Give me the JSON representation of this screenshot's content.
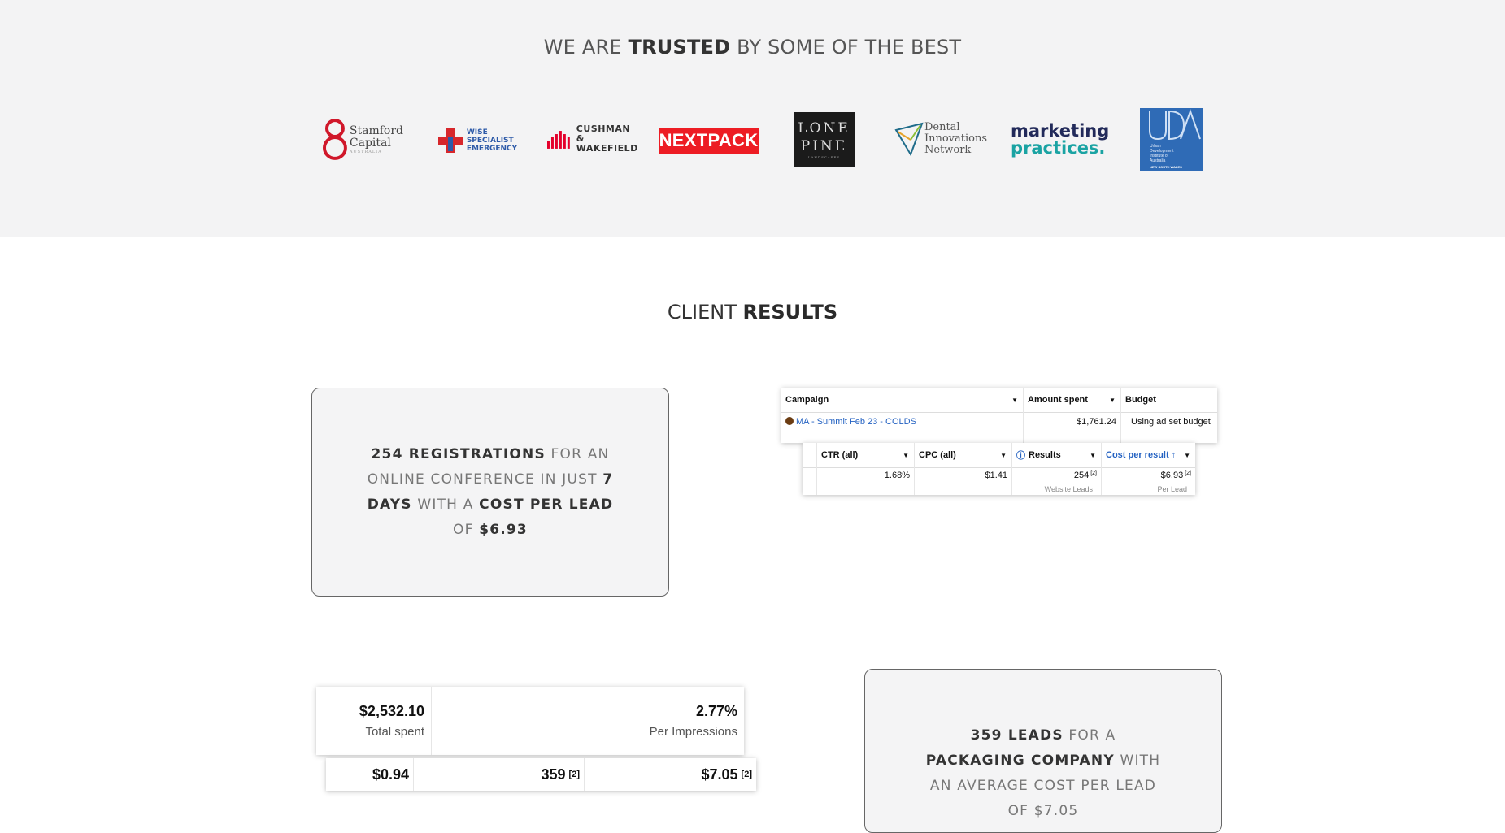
{
  "trusted": {
    "title_pre": "WE ARE ",
    "title_bold": "TRUSTED",
    "title_post": " BY SOME OF THE BEST",
    "logos": {
      "stamford": {
        "line1": "Stamford",
        "line2": "Capital",
        "line3": "AUSTRALIA"
      },
      "wise": {
        "line1": "WISE",
        "line2": "SPECIALIST",
        "line3": "EMERGENCY"
      },
      "cushman": {
        "line1": "CUSHMAN &",
        "line2": "WAKEFIELD"
      },
      "nextpack": "NEXTPACK",
      "lonepine": {
        "line1": "LONE",
        "line2": "PINE",
        "line3": "LANDSCAPES"
      },
      "dental": {
        "line1": "Dental",
        "line2": "Innovations",
        "line3": "Network"
      },
      "marketing": {
        "line1": "marketing",
        "line2": "practices."
      },
      "uda": {
        "text": "Urban Development Institute of Australia",
        "footer": "NEW SOUTH WALES"
      }
    }
  },
  "client_results": {
    "title_pre": "CLIENT ",
    "title_bold": "RESULTS"
  },
  "card1": {
    "b1": "254 REGISTRATIONS",
    "t1": " FOR AN ONLINE CONFERENCE IN JUST ",
    "b2": "7 DAYS",
    "t2": " WITH A ",
    "b3": "COST PER LEAD",
    "t3": " OF ",
    "b4": "$6.93"
  },
  "ads_table_1": {
    "headers": [
      "Campaign",
      "Amount spent",
      "Budget"
    ],
    "row": {
      "campaign": "MA - Summit Feb 23 - COLDS",
      "amount": "$1,761.24",
      "budget": "Using ad set budget"
    }
  },
  "ads_table_2": {
    "headers": [
      "CTR (all)",
      "CPC (all)",
      "Results",
      "Cost per result"
    ],
    "row": {
      "ctr": "1.68%",
      "cpc": "$1.41",
      "results": "254",
      "results_sup": "[2]",
      "results_sub": "Website Leads",
      "cost": "$6.93",
      "cost_sup": "[2]",
      "cost_sub": "Per Lead"
    }
  },
  "stats_1": {
    "total_spent_value": "$2,532.10",
    "total_spent_label": "Total spent",
    "per_impr_value": "2.77%",
    "per_impr_label": "Per Impressions"
  },
  "stats_2": {
    "v1": "$0.94",
    "v2": "359",
    "v2_sup": "[2]",
    "v3": "$7.05",
    "v3_sup": "[2]"
  },
  "card2": {
    "b1": "359 LEADS",
    "t1": " FOR A ",
    "b2": "PACKAGING COMPANY",
    "t2": " WITH AN AVERAGE COST PER LEAD OF $7.05"
  }
}
